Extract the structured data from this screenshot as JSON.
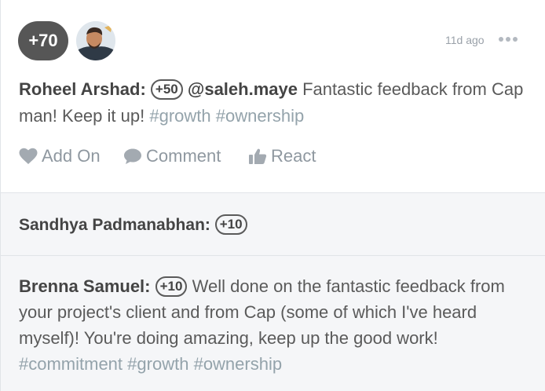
{
  "post": {
    "points_total": "+70",
    "timestamp": "11d ago",
    "author": "Roheel Arshad:",
    "points": "+50",
    "mention": "@saleh.maye",
    "message": "Fantastic feedback from Cap man! Keep it up!",
    "tags": [
      "#growth",
      "#ownership"
    ]
  },
  "actions": {
    "add_on": "Add On",
    "comment": "Comment",
    "react": "React"
  },
  "addons": [
    {
      "author": "Sandhya Padmanabhan:",
      "points": "+10",
      "message": "",
      "tags": []
    },
    {
      "author": "Brenna Samuel:",
      "points": "+10",
      "message": "Well done on the fantastic feedback from your project's client and from Cap (some of which I've heard myself)! You're doing amazing, keep up the good work!",
      "tags": [
        "#commitment",
        "#growth",
        "#ownership"
      ]
    }
  ],
  "icons": {
    "more": "more-dots-icon",
    "add_on": "heart-icon",
    "comment": "speech-bubble-icon",
    "react": "thumbs-up-icon"
  }
}
